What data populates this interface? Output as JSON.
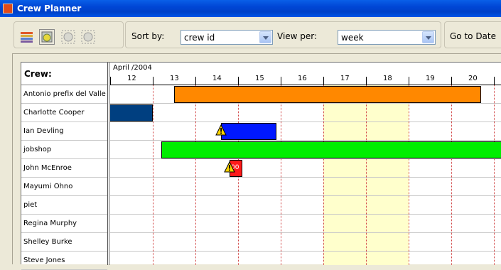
{
  "window": {
    "title": "Crew Planner"
  },
  "toolbar": {
    "sort_label": "Sort by:",
    "sort_value": "crew id",
    "view_label": "View per:",
    "view_value": "week",
    "goto_label": "Go to Date"
  },
  "grid": {
    "crew_header": "Crew:",
    "month_label": "April /2004",
    "days": [
      "12",
      "13",
      "14",
      "15",
      "16",
      "17",
      "18",
      "19",
      "20"
    ],
    "crew": [
      "Antonio prefix del Valle",
      "Charlotte Cooper",
      "Ian Devling",
      " jobshop",
      "John McEnroe",
      "Mayumi Ohno",
      " piet",
      "Regina Murphy",
      "Shelley Burke",
      "Steve Jones"
    ],
    "assignments": [
      {
        "crew": "Antonio prefix del Valle",
        "color": "#ff8800",
        "start": "13.5",
        "end": "20.7"
      },
      {
        "crew": "Charlotte Cooper",
        "color": "#003f80",
        "start": "11.9",
        "end": "13.0"
      },
      {
        "crew": "Ian Devling",
        "color": "#0018ff",
        "start": "14.6",
        "end": "15.9",
        "warning": true
      },
      {
        "crew": " jobshop",
        "color": "#00ee00",
        "start": "13.2",
        "end": "21.5"
      },
      {
        "crew": "John McEnroe",
        "color": "#ff1a1a",
        "start": "14.8",
        "end": "15.1",
        "warning": true,
        "text": "00"
      }
    ],
    "weekend_color": "#ffffcc"
  }
}
